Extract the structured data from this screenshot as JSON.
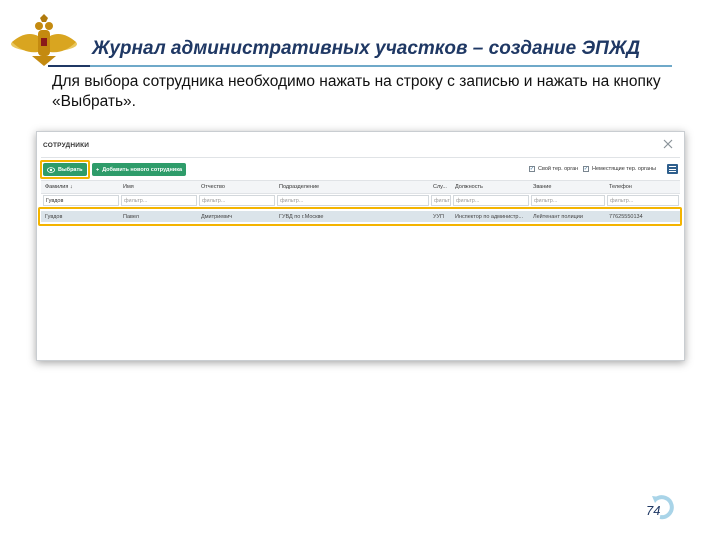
{
  "slide": {
    "title": "Журнал административных участков – создание ЭПЖД",
    "instruction": "Для выбора сотрудника необходимо нажать на строку с записью и нажать на кнопку «Выбрать».",
    "page_number": "74",
    "emblem_icon": "double-headed-eagle-emblem",
    "accent_color": "#1f3864",
    "highlight_color": "#f4b400"
  },
  "dialog": {
    "title": "СОТРУДНИКИ",
    "close_icon": "close-icon",
    "buttons": {
      "select_label": "Выбрать",
      "select_icon": "eye-icon",
      "add_label": "Добавить нового сотрудника",
      "add_icon": "plus-icon",
      "color": "#2e9c6a"
    },
    "checkboxes": [
      {
        "label": "Свой тер. орган",
        "checked": true
      },
      {
        "label": "Неместящие тер. органы",
        "checked": true
      }
    ],
    "columns": [
      "Фамилия ↓",
      "Имя",
      "Отчество",
      "Подразделение",
      "Слу...",
      "Должность",
      "Звание",
      "Телефон"
    ],
    "filters": [
      "Гувдов",
      "фильтр...",
      "фильтр...",
      "фильтр...",
      "фильт",
      "фильтр...",
      "фильтр...",
      "фильтр..."
    ],
    "rows": [
      [
        "Гувдов",
        "Павел",
        "Дмитриевич",
        "ГУВД по г.Москве",
        "УУП",
        "Инспектор по администр...",
        "Лейтенант полиции",
        "77625550134"
      ]
    ]
  }
}
